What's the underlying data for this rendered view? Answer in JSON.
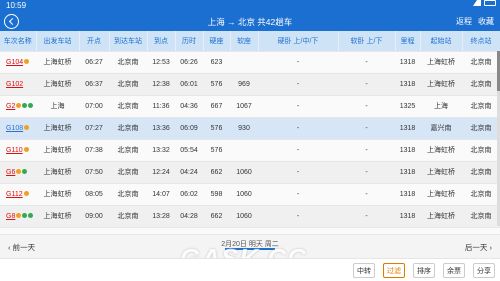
{
  "statusbar": {
    "time": "10:59"
  },
  "appbar": {
    "title": "上海 → 北京 共42趟车",
    "return_label": "返程",
    "favorite_label": "收藏"
  },
  "table": {
    "headers": [
      "车次名称",
      "出发车站",
      "开点",
      "到达车站",
      "到点",
      "历时",
      "硬座",
      "软座",
      "硬卧 上/中/下",
      "软卧 上/下",
      "里程",
      "起始站",
      "终点站"
    ],
    "rows": [
      {
        "code": "G104",
        "badges": [
          "o"
        ],
        "from": "上海虹桥",
        "dep": "06:27",
        "to": "北京南",
        "arr": "12:53",
        "dur": "06:26",
        "hard_seat": "623",
        "soft_seat": "",
        "hard_sleeper": "-",
        "soft_sleeper": "-",
        "dist": "1318",
        "start": "上海虹桥",
        "end": "北京南"
      },
      {
        "code": "G102",
        "badges": [],
        "from": "上海虹桥",
        "dep": "06:37",
        "to": "北京南",
        "arr": "12:38",
        "dur": "06:01",
        "hard_seat": "576",
        "soft_seat": "969",
        "hard_sleeper": "-",
        "soft_sleeper": "-",
        "dist": "1318",
        "start": "上海虹桥",
        "end": "北京南"
      },
      {
        "code": "G2",
        "badges": [
          "o",
          "g",
          "g"
        ],
        "from": "上海",
        "dep": "07:00",
        "to": "北京南",
        "arr": "11:36",
        "dur": "04:36",
        "hard_seat": "667",
        "soft_seat": "1067",
        "hard_sleeper": "-",
        "soft_sleeper": "-",
        "dist": "1325",
        "start": "上海",
        "end": "北京南"
      },
      {
        "code": "G108",
        "badges": [
          "o"
        ],
        "from": "上海虹桥",
        "dep": "07:27",
        "to": "北京南",
        "arr": "13:36",
        "dur": "06:09",
        "hard_seat": "576",
        "soft_seat": "930",
        "hard_sleeper": "-",
        "soft_sleeper": "-",
        "dist": "1318",
        "start": "嘉兴南",
        "end": "北京南"
      },
      {
        "code": "G110",
        "badges": [
          "o"
        ],
        "from": "上海虹桥",
        "dep": "07:38",
        "to": "北京南",
        "arr": "13:32",
        "dur": "05:54",
        "hard_seat": "576",
        "soft_seat": "",
        "hard_sleeper": "-",
        "soft_sleeper": "-",
        "dist": "1318",
        "start": "上海虹桥",
        "end": "北京南"
      },
      {
        "code": "G6",
        "badges": [
          "o",
          "g"
        ],
        "from": "上海虹桥",
        "dep": "07:50",
        "to": "北京南",
        "arr": "12:24",
        "dur": "04:24",
        "hard_seat": "662",
        "soft_seat": "1060",
        "hard_sleeper": "-",
        "soft_sleeper": "-",
        "dist": "1318",
        "start": "上海虹桥",
        "end": "北京南"
      },
      {
        "code": "G112",
        "badges": [
          "o"
        ],
        "from": "上海虹桥",
        "dep": "08:05",
        "to": "北京南",
        "arr": "14:07",
        "dur": "06:02",
        "hard_seat": "598",
        "soft_seat": "1060",
        "hard_sleeper": "-",
        "soft_sleeper": "-",
        "dist": "1318",
        "start": "上海虹桥",
        "end": "北京南"
      },
      {
        "code": "G8",
        "badges": [
          "o",
          "g",
          "g"
        ],
        "from": "上海虹桥",
        "dep": "09:00",
        "to": "北京南",
        "arr": "13:28",
        "dur": "04:28",
        "hard_seat": "662",
        "soft_seat": "1060",
        "hard_sleeper": "-",
        "soft_sleeper": "-",
        "dist": "1318",
        "start": "上海虹桥",
        "end": "北京南"
      },
      {
        "code": "G116",
        "badges": [
          "o"
        ],
        "from": "上海虹桥",
        "dep": "09:26",
        "to": "北京南",
        "arr": "15:22",
        "dur": "05:56",
        "hard_seat": "576",
        "soft_seat": "",
        "hard_sleeper": "-",
        "soft_sleeper": "-",
        "dist": "1318",
        "start": "上海虹桥",
        "end": "北京南"
      }
    ]
  },
  "navbar": {
    "prev_label": "前一天",
    "date_label": "2月20日 明天 周二",
    "next_label": "后一天"
  },
  "bottombar": {
    "buttons": [
      "中转",
      "过滤",
      "排序",
      "余票",
      "分享"
    ]
  },
  "watermark": "GASK.CC"
}
